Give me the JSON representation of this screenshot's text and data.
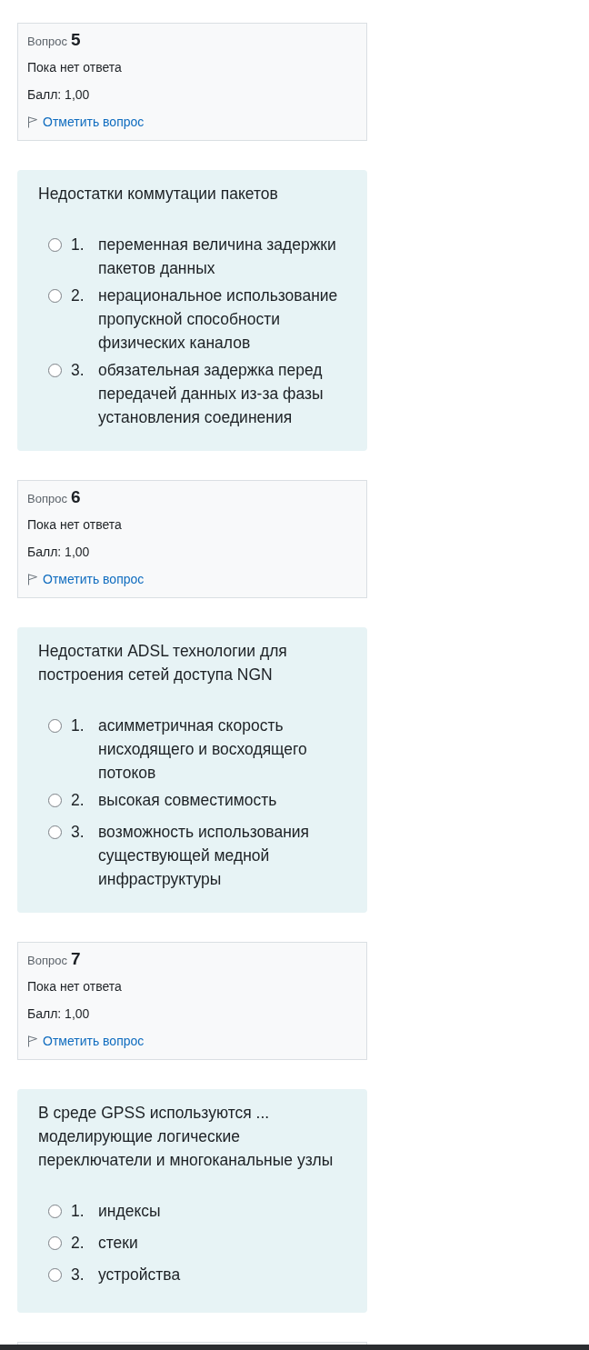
{
  "questions": [
    {
      "label": "Вопрос",
      "number": "5",
      "status": "Пока нет ответа",
      "score": "Балл: 1,00",
      "flag_link": "Отметить вопрос",
      "prompt": "Недостатки коммутации пакетов",
      "options": [
        {
          "number": "1.",
          "text": "переменная величина задержки пакетов данных",
          "selected": false
        },
        {
          "number": "2.",
          "text": "нерациональное использование пропускной способности физических каналов",
          "selected": false
        },
        {
          "number": "3.",
          "text": "обязательная задержка перед передачей данных из-за фазы установления соединения",
          "selected": false
        }
      ]
    },
    {
      "label": "Вопрос",
      "number": "6",
      "status": "Пока нет ответа",
      "score": "Балл: 1,00",
      "flag_link": "Отметить вопрос",
      "prompt": "Недостатки ADSL технологии для построения сетей доступа NGN",
      "options": [
        {
          "number": "1.",
          "text": "асимметричная скорость нисходящего и восходящего потоков",
          "selected": false
        },
        {
          "number": "2.",
          "text": "высокая совместимость",
          "selected": false
        },
        {
          "number": "3.",
          "text": "возможность использования существующей медной инфраструктуры",
          "selected": false
        }
      ]
    },
    {
      "label": "Вопрос",
      "number": "7",
      "status": "Пока нет ответа",
      "score": "Балл: 1,00",
      "flag_link": "Отметить вопрос",
      "prompt": "В среде GPSS используются ... моделирующие логические переключатели и многоканальные узлы",
      "options": [
        {
          "number": "1.",
          "text": "индексы",
          "selected": false
        },
        {
          "number": "2.",
          "text": "стеки",
          "selected": false
        },
        {
          "number": "3.",
          "text": "устройства",
          "selected": false
        }
      ]
    }
  ]
}
